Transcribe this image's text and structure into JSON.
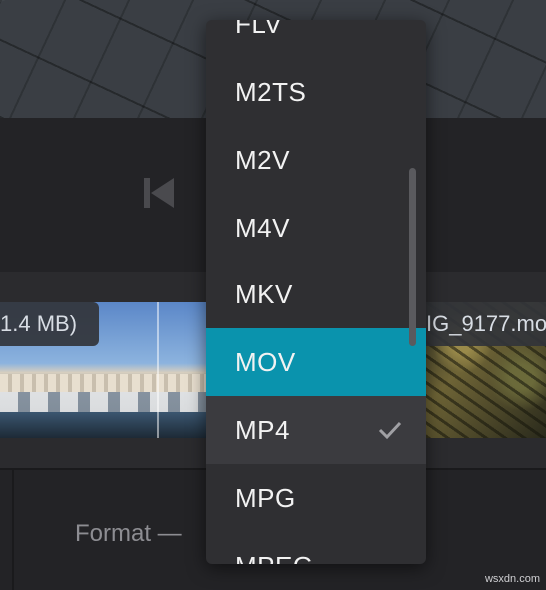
{
  "timeline": {
    "left_clip_size": "1.4 MB)",
    "right_clip_name": "IG_9177.mo"
  },
  "format": {
    "label": "Format —"
  },
  "dropdown": {
    "options": [
      {
        "label": "FLV"
      },
      {
        "label": "M2TS"
      },
      {
        "label": "M2V"
      },
      {
        "label": "M4V"
      },
      {
        "label": "MKV"
      },
      {
        "label": "MOV",
        "highlighted": true
      },
      {
        "label": "MP4",
        "checked": true
      },
      {
        "label": "MPG"
      },
      {
        "label": "MPEG"
      }
    ],
    "accent_color": "#0a93ad"
  },
  "icons": {
    "previous": "skip-previous-icon",
    "check": "check-icon"
  },
  "watermark": "wsxdn.com"
}
